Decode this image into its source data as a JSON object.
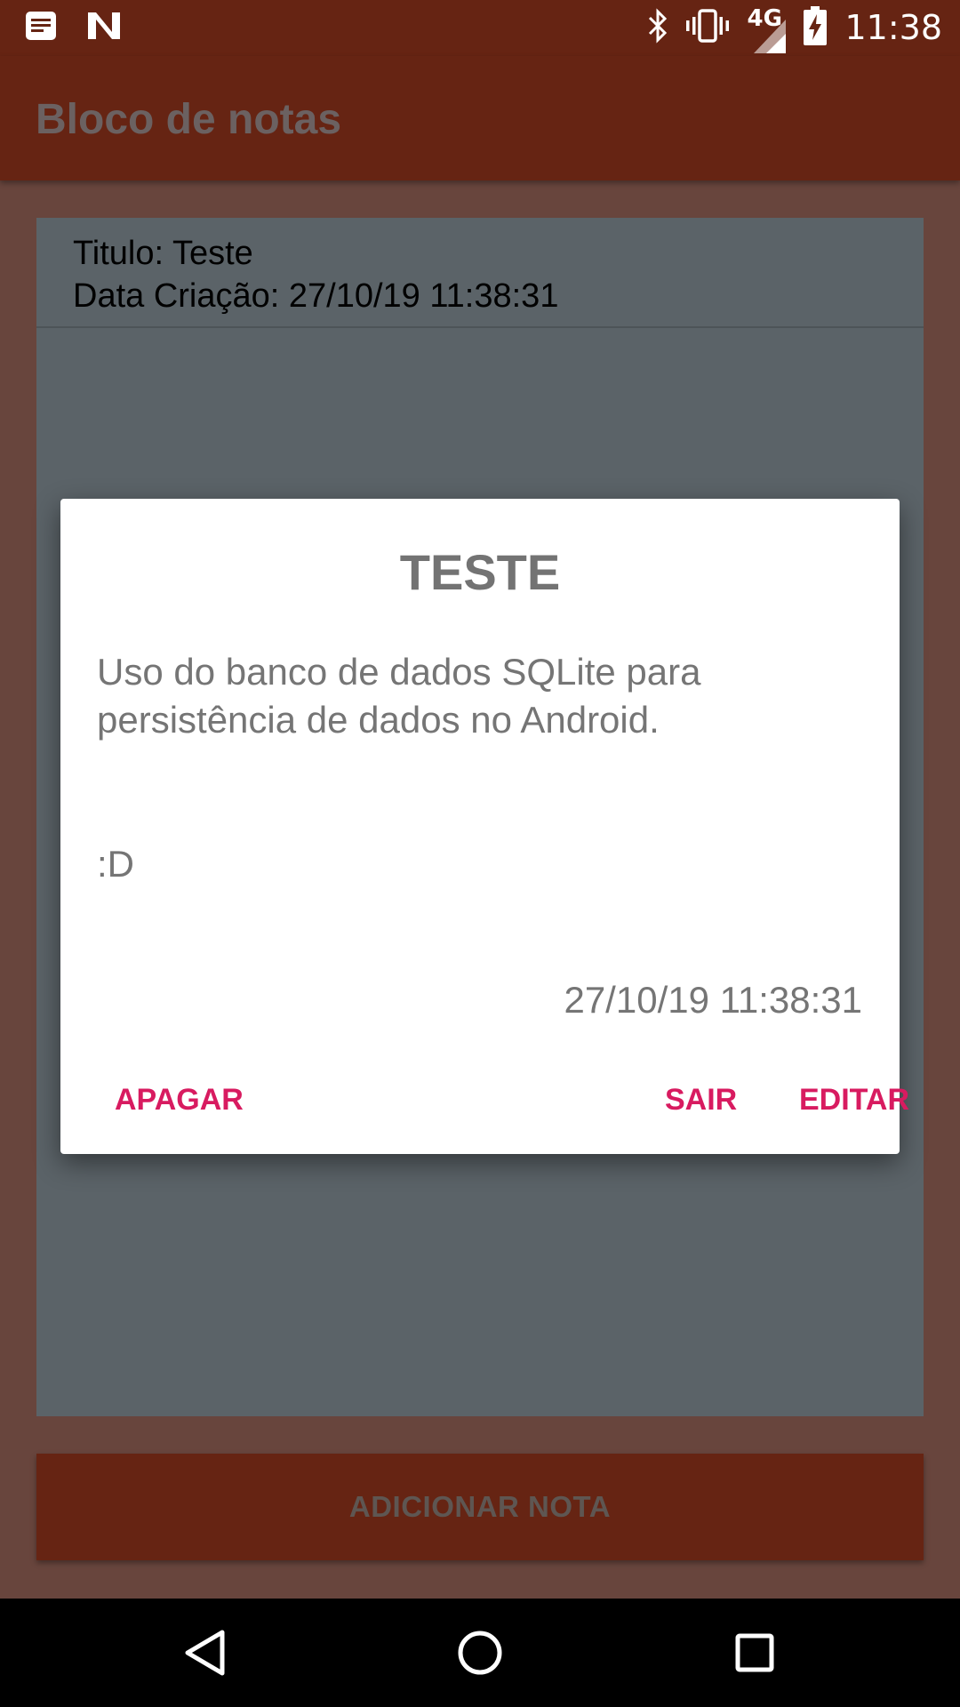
{
  "status_bar": {
    "time": "11:38",
    "network": "4G",
    "icons": [
      "notification-news-icon",
      "n-notification-icon",
      "bluetooth-icon",
      "vibrate-icon",
      "signal-icon",
      "battery-charging-icon"
    ]
  },
  "app_bar": {
    "title": "Bloco de notas"
  },
  "notes": [
    {
      "title_line": "Titulo: Teste",
      "date_line": "Data Criação: 27/10/19 11:38:31"
    }
  ],
  "add_button": {
    "label": "ADICIONAR NOTA"
  },
  "dialog": {
    "title": "TESTE",
    "body": "Uso do banco de dados SQLite para persistência de dados no Android.",
    "extra": ":D",
    "date": "27/10/19 11:38:31",
    "buttons": {
      "delete": "APAGAR",
      "exit": "SAIR",
      "edit": "EDITAR"
    }
  },
  "nav_bar": {
    "icons": [
      "back-icon",
      "home-icon",
      "recents-icon"
    ]
  },
  "colors": {
    "primary": "#662413",
    "accent": "#d81b60",
    "list_bg": "#5b6368"
  }
}
